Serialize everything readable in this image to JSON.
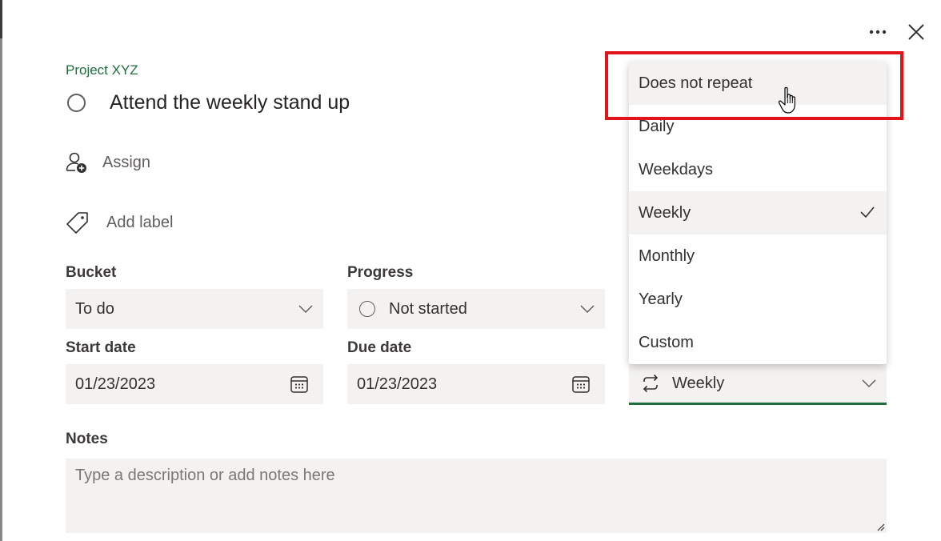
{
  "header": {
    "more_icon": "ellipsis-icon",
    "close_icon": "close-icon"
  },
  "task": {
    "project": "Project XYZ",
    "title": "Attend the weekly stand up"
  },
  "assign": {
    "label": "Assign",
    "icon": "add-person-icon"
  },
  "label": {
    "label": "Add label",
    "icon": "tag-icon"
  },
  "bucket": {
    "label": "Bucket",
    "value": "To do"
  },
  "progress": {
    "label": "Progress",
    "value": "Not started"
  },
  "start_date": {
    "label": "Start date",
    "value": "01/23/2023"
  },
  "due_date": {
    "label": "Due date",
    "value": "01/23/2023"
  },
  "repeat": {
    "value": "Weekly",
    "icon": "repeat-icon"
  },
  "notes": {
    "label": "Notes",
    "placeholder": "Type a description or add notes here"
  },
  "repeat_options": {
    "items": [
      "Does not repeat",
      "Daily",
      "Weekdays",
      "Weekly",
      "Monthly",
      "Yearly",
      "Custom"
    ],
    "selected": "Weekly",
    "hovered": "Does not repeat"
  },
  "colors": {
    "accent": "#1e6e3c",
    "highlight": "#e0141a"
  }
}
